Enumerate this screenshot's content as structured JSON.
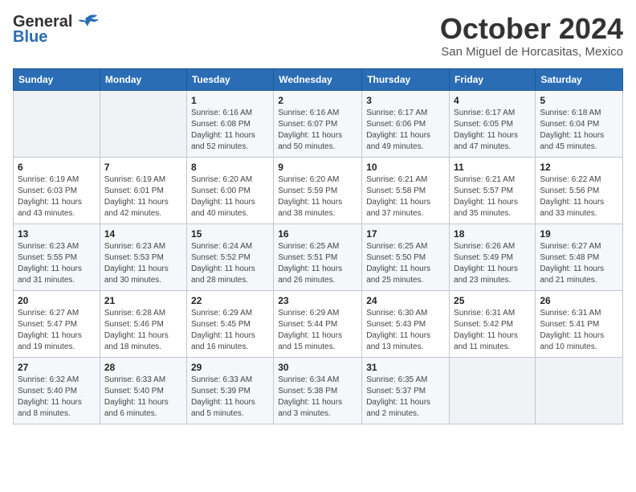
{
  "logo": {
    "line1": "General",
    "line2": "Blue"
  },
  "title": "October 2024",
  "subtitle": "San Miguel de Horcasitas, Mexico",
  "days_header": [
    "Sunday",
    "Monday",
    "Tuesday",
    "Wednesday",
    "Thursday",
    "Friday",
    "Saturday"
  ],
  "weeks": [
    [
      {
        "day": "",
        "info": ""
      },
      {
        "day": "",
        "info": ""
      },
      {
        "day": "1",
        "info": "Sunrise: 6:16 AM\nSunset: 6:08 PM\nDaylight: 11 hours and 52 minutes."
      },
      {
        "day": "2",
        "info": "Sunrise: 6:16 AM\nSunset: 6:07 PM\nDaylight: 11 hours and 50 minutes."
      },
      {
        "day": "3",
        "info": "Sunrise: 6:17 AM\nSunset: 6:06 PM\nDaylight: 11 hours and 49 minutes."
      },
      {
        "day": "4",
        "info": "Sunrise: 6:17 AM\nSunset: 6:05 PM\nDaylight: 11 hours and 47 minutes."
      },
      {
        "day": "5",
        "info": "Sunrise: 6:18 AM\nSunset: 6:04 PM\nDaylight: 11 hours and 45 minutes."
      }
    ],
    [
      {
        "day": "6",
        "info": "Sunrise: 6:19 AM\nSunset: 6:03 PM\nDaylight: 11 hours and 43 minutes."
      },
      {
        "day": "7",
        "info": "Sunrise: 6:19 AM\nSunset: 6:01 PM\nDaylight: 11 hours and 42 minutes."
      },
      {
        "day": "8",
        "info": "Sunrise: 6:20 AM\nSunset: 6:00 PM\nDaylight: 11 hours and 40 minutes."
      },
      {
        "day": "9",
        "info": "Sunrise: 6:20 AM\nSunset: 5:59 PM\nDaylight: 11 hours and 38 minutes."
      },
      {
        "day": "10",
        "info": "Sunrise: 6:21 AM\nSunset: 5:58 PM\nDaylight: 11 hours and 37 minutes."
      },
      {
        "day": "11",
        "info": "Sunrise: 6:21 AM\nSunset: 5:57 PM\nDaylight: 11 hours and 35 minutes."
      },
      {
        "day": "12",
        "info": "Sunrise: 6:22 AM\nSunset: 5:56 PM\nDaylight: 11 hours and 33 minutes."
      }
    ],
    [
      {
        "day": "13",
        "info": "Sunrise: 6:23 AM\nSunset: 5:55 PM\nDaylight: 11 hours and 31 minutes."
      },
      {
        "day": "14",
        "info": "Sunrise: 6:23 AM\nSunset: 5:53 PM\nDaylight: 11 hours and 30 minutes."
      },
      {
        "day": "15",
        "info": "Sunrise: 6:24 AM\nSunset: 5:52 PM\nDaylight: 11 hours and 28 minutes."
      },
      {
        "day": "16",
        "info": "Sunrise: 6:25 AM\nSunset: 5:51 PM\nDaylight: 11 hours and 26 minutes."
      },
      {
        "day": "17",
        "info": "Sunrise: 6:25 AM\nSunset: 5:50 PM\nDaylight: 11 hours and 25 minutes."
      },
      {
        "day": "18",
        "info": "Sunrise: 6:26 AM\nSunset: 5:49 PM\nDaylight: 11 hours and 23 minutes."
      },
      {
        "day": "19",
        "info": "Sunrise: 6:27 AM\nSunset: 5:48 PM\nDaylight: 11 hours and 21 minutes."
      }
    ],
    [
      {
        "day": "20",
        "info": "Sunrise: 6:27 AM\nSunset: 5:47 PM\nDaylight: 11 hours and 19 minutes."
      },
      {
        "day": "21",
        "info": "Sunrise: 6:28 AM\nSunset: 5:46 PM\nDaylight: 11 hours and 18 minutes."
      },
      {
        "day": "22",
        "info": "Sunrise: 6:29 AM\nSunset: 5:45 PM\nDaylight: 11 hours and 16 minutes."
      },
      {
        "day": "23",
        "info": "Sunrise: 6:29 AM\nSunset: 5:44 PM\nDaylight: 11 hours and 15 minutes."
      },
      {
        "day": "24",
        "info": "Sunrise: 6:30 AM\nSunset: 5:43 PM\nDaylight: 11 hours and 13 minutes."
      },
      {
        "day": "25",
        "info": "Sunrise: 6:31 AM\nSunset: 5:42 PM\nDaylight: 11 hours and 11 minutes."
      },
      {
        "day": "26",
        "info": "Sunrise: 6:31 AM\nSunset: 5:41 PM\nDaylight: 11 hours and 10 minutes."
      }
    ],
    [
      {
        "day": "27",
        "info": "Sunrise: 6:32 AM\nSunset: 5:40 PM\nDaylight: 11 hours and 8 minutes."
      },
      {
        "day": "28",
        "info": "Sunrise: 6:33 AM\nSunset: 5:40 PM\nDaylight: 11 hours and 6 minutes."
      },
      {
        "day": "29",
        "info": "Sunrise: 6:33 AM\nSunset: 5:39 PM\nDaylight: 11 hours and 5 minutes."
      },
      {
        "day": "30",
        "info": "Sunrise: 6:34 AM\nSunset: 5:38 PM\nDaylight: 11 hours and 3 minutes."
      },
      {
        "day": "31",
        "info": "Sunrise: 6:35 AM\nSunset: 5:37 PM\nDaylight: 11 hours and 2 minutes."
      },
      {
        "day": "",
        "info": ""
      },
      {
        "day": "",
        "info": ""
      }
    ]
  ]
}
